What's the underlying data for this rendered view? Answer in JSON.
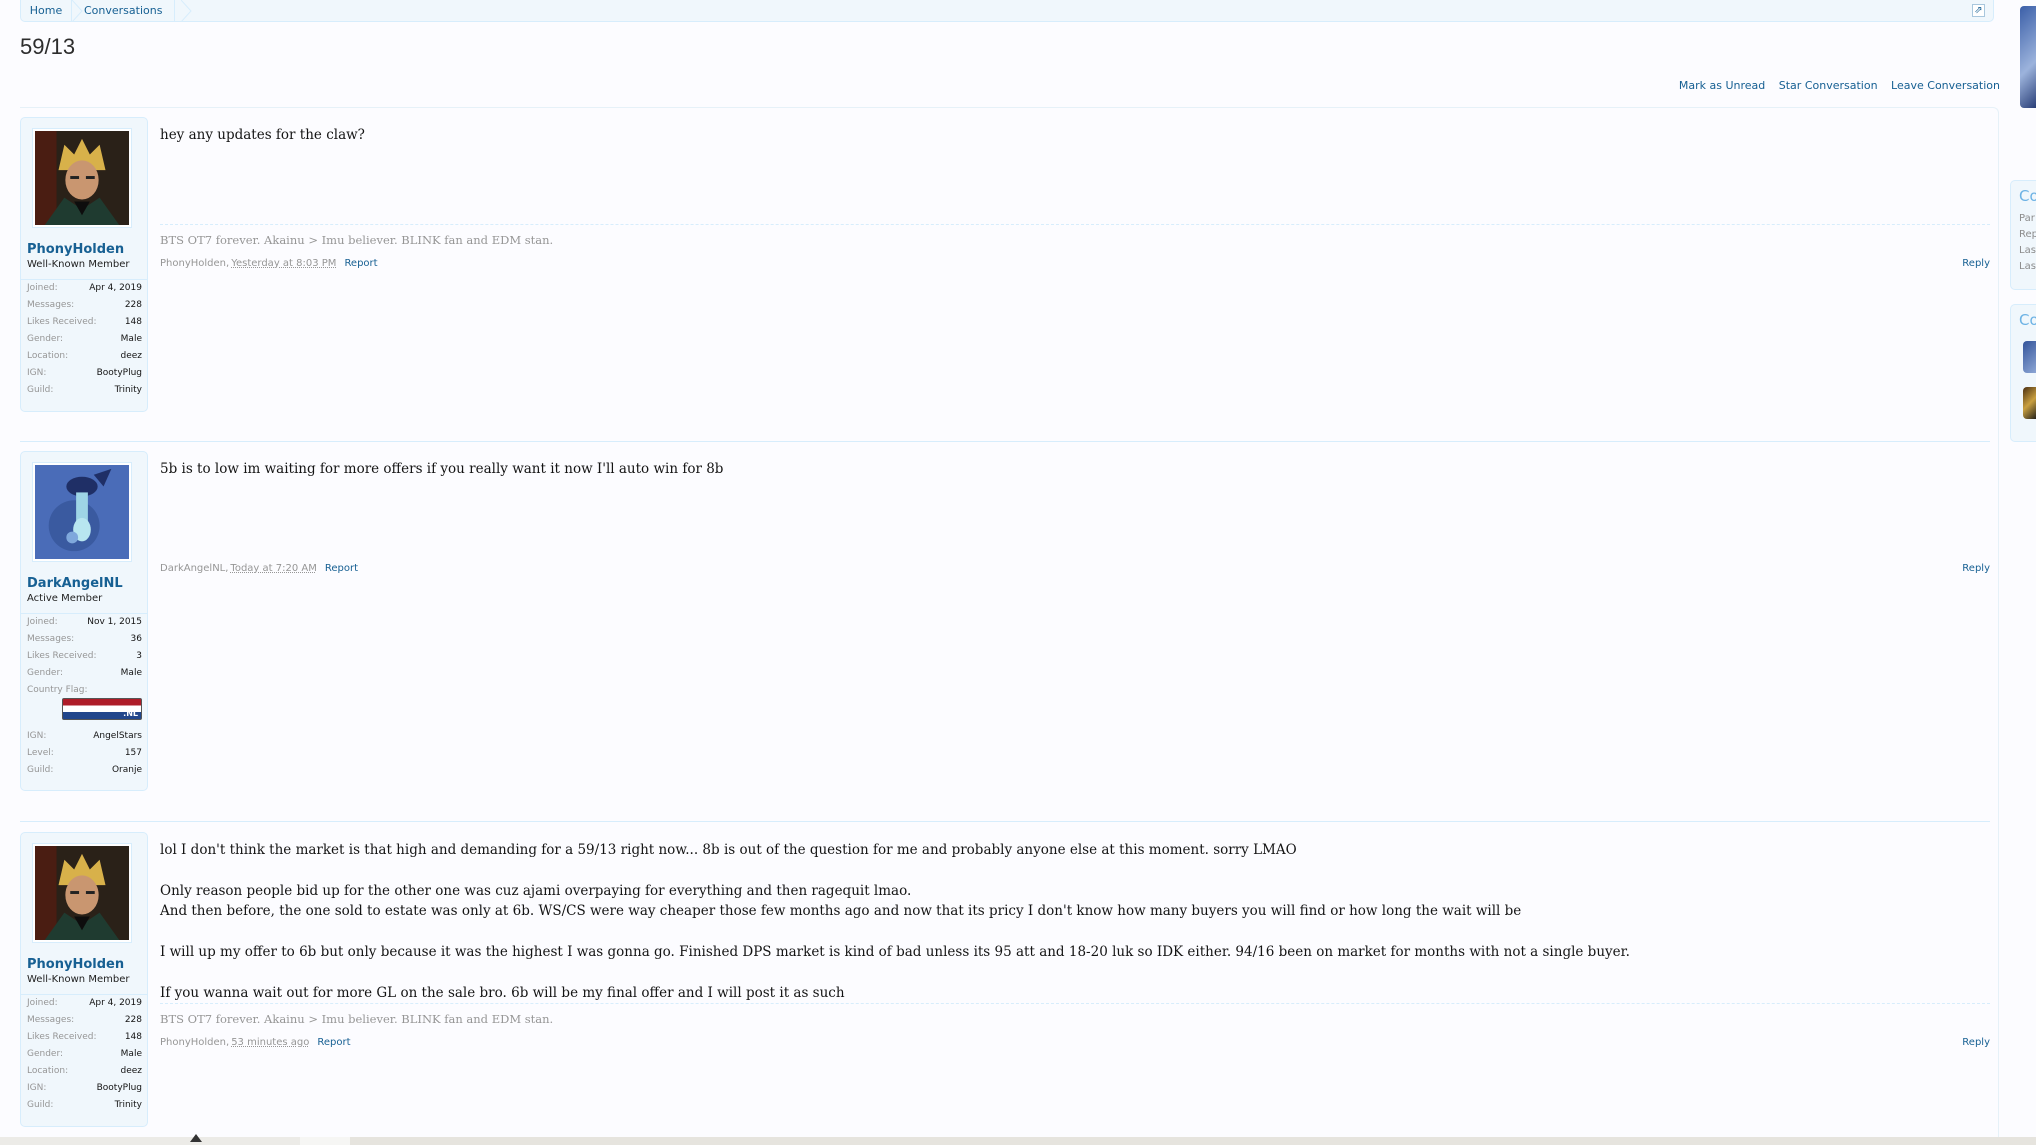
{
  "breadcrumb": {
    "home": "Home",
    "conversations": "Conversations"
  },
  "page_title": "59/13",
  "actions": {
    "mark_unread": "Mark as Unread",
    "star": "Star Conversation",
    "leave": "Leave Conversation"
  },
  "sidebar_fragments": {
    "panel1_heading": "Co",
    "panel1_lines": [
      "Par",
      "Rep",
      "Las",
      "Las"
    ],
    "panel2_heading": "Co"
  },
  "messages": [
    {
      "username": "PhonyHolden",
      "usertitle": "Well-Known Member",
      "info": [
        {
          "k": "Joined:",
          "v": "Apr 4, 2019"
        },
        {
          "k": "Messages:",
          "v": "228"
        },
        {
          "k": "Likes Received:",
          "v": "148"
        },
        {
          "k": "Gender:",
          "v": "Male"
        },
        {
          "k": "Location:",
          "v": "deez"
        },
        {
          "k": "IGN:",
          "v": "BootyPlug"
        },
        {
          "k": "Guild:",
          "v": "Trinity"
        }
      ],
      "body": [
        "hey any updates for the claw?"
      ],
      "signature": "BTS OT7 forever. Akainu > Imu believer. BLINK fan and EDM stan.",
      "author": "PhonyHolden,",
      "date": "Yesterday at 8:03 PM",
      "report": "Report",
      "reply": "Reply"
    },
    {
      "username": "DarkAngelNL",
      "usertitle": "Active Member",
      "info": [
        {
          "k": "Joined:",
          "v": "Nov 1, 2015"
        },
        {
          "k": "Messages:",
          "v": "36"
        },
        {
          "k": "Likes Received:",
          "v": "3"
        },
        {
          "k": "Gender:",
          "v": "Male"
        }
      ],
      "flag_label": "Country Flag:",
      "flag_text": ".NL",
      "info2": [
        {
          "k": "IGN:",
          "v": "AngelStars"
        },
        {
          "k": "Level:",
          "v": "157"
        },
        {
          "k": "Guild:",
          "v": "Oranje"
        }
      ],
      "body": [
        "5b is to low im waiting for more offers if you really want it now I'll auto win for 8b"
      ],
      "author": "DarkAngelNL,",
      "date": "Today at 7:20 AM",
      "report": "Report",
      "reply": "Reply"
    },
    {
      "username": "PhonyHolden",
      "usertitle": "Well-Known Member",
      "info": [
        {
          "k": "Joined:",
          "v": "Apr 4, 2019"
        },
        {
          "k": "Messages:",
          "v": "228"
        },
        {
          "k": "Likes Received:",
          "v": "148"
        },
        {
          "k": "Gender:",
          "v": "Male"
        },
        {
          "k": "Location:",
          "v": "deez"
        },
        {
          "k": "IGN:",
          "v": "BootyPlug"
        },
        {
          "k": "Guild:",
          "v": "Trinity"
        }
      ],
      "body": [
        "lol I don't think the market is that high and demanding for a 59/13 right now... 8b is out of the question for me and probably anyone else at this moment. sorry LMAO",
        "Only reason people bid up for the other one was cuz ajami overpaying for everything and then ragequit lmao.",
        "And then before, the one sold to estate was only at 6b. WS/CS were way cheaper those few months ago and now that its pricy I don't know how many buyers you will find or how long the wait will be",
        "I will up my offer to 6b but only because it was the highest I was gonna go. Finished DPS market is kind of bad unless its 95 att and 18-20 luk so IDK either. 94/16 been on market for months with not a single buyer.",
        "If you wanna wait out for more GL on the sale bro. 6b will be my final offer and I will post it as such"
      ],
      "signature": "BTS OT7 forever. Akainu > Imu believer. BLINK fan and EDM stan.",
      "author": "PhonyHolden,",
      "date": "53 minutes ago",
      "report": "Report",
      "reply": "Reply"
    }
  ]
}
